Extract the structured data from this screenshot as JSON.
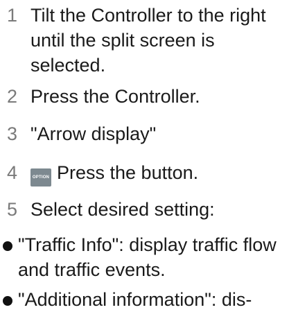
{
  "steps": [
    {
      "num": "1",
      "text": "Tilt the Controller to the right until the split screen is selected."
    },
    {
      "num": "2",
      "text": "Press the Controller."
    },
    {
      "num": "3",
      "text": "\"Arrow display\""
    },
    {
      "num": "4",
      "button_label": "OPTION",
      "text": "Press the button."
    },
    {
      "num": "5",
      "text": "Select desired setting:"
    }
  ],
  "bullets": [
    {
      "text": "\"Traffic Info\": display traffic flow and traffic events."
    },
    {
      "text": "\"Additional information\": dis-"
    }
  ],
  "colors": {
    "step_number": "#7a7a7a",
    "body_text": "#1a1a1a",
    "option_button": "#7d8990"
  }
}
